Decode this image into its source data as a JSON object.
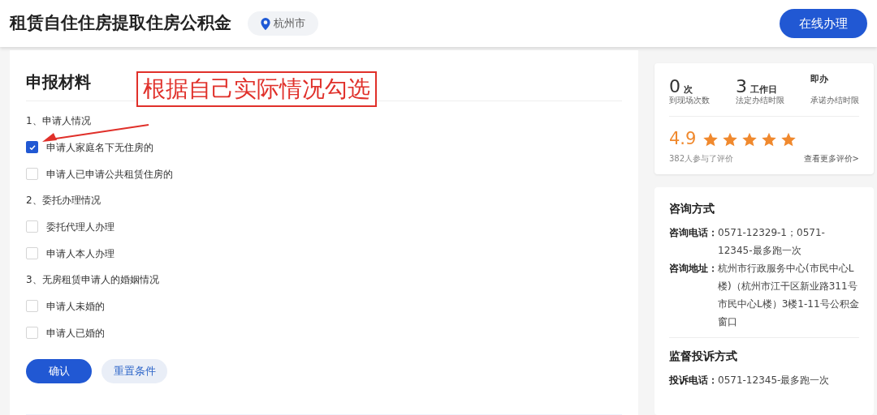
{
  "header": {
    "title": "租赁自住住房提取住房公积金",
    "location": "杭州市",
    "action": "在线办理"
  },
  "materials": {
    "title": "申报材料",
    "annotation": "根据自己实际情况勾选",
    "groups": [
      {
        "label": "1、申请人情况",
        "options": [
          {
            "label": "申请人家庭名下无住房的",
            "checked": true
          },
          {
            "label": "申请人已申请公共租赁住房的",
            "checked": false
          }
        ]
      },
      {
        "label": "2、委托办理情况",
        "options": [
          {
            "label": "委托代理人办理",
            "checked": false
          },
          {
            "label": "申请人本人办理",
            "checked": false
          }
        ]
      },
      {
        "label": "3、无房租赁申请人的婚姻情况",
        "options": [
          {
            "label": "申请人未婚的",
            "checked": false
          },
          {
            "label": "申请人已婚的",
            "checked": false
          }
        ]
      }
    ],
    "confirm": "确认",
    "reset": "重置条件"
  },
  "stats": [
    {
      "value": "0",
      "unit": "次",
      "label": "到现场次数"
    },
    {
      "value": "3",
      "unit": "工作日",
      "label": "法定办结时限"
    },
    {
      "unit": "即办",
      "label": "承诺办结时限"
    }
  ],
  "rating": {
    "score": "4.9",
    "stars": 5,
    "count": "382人参与了评价",
    "more": "查看更多评价>"
  },
  "consult": {
    "title": "咨询方式",
    "items": [
      {
        "label": "咨询电话：",
        "value": "0571-12329-1；0571-12345-最多跑一次"
      },
      {
        "label": "咨询地址：",
        "value": "杭州市行政服务中心(市民中心L楼)（杭州市江干区新业路311号市民中心L楼）3楼1-11号公积金窗口"
      }
    ]
  },
  "complaint": {
    "title": "监督投诉方式",
    "items": [
      {
        "label": "投诉电话：",
        "value": "0571-12345-最多跑一次"
      }
    ]
  }
}
